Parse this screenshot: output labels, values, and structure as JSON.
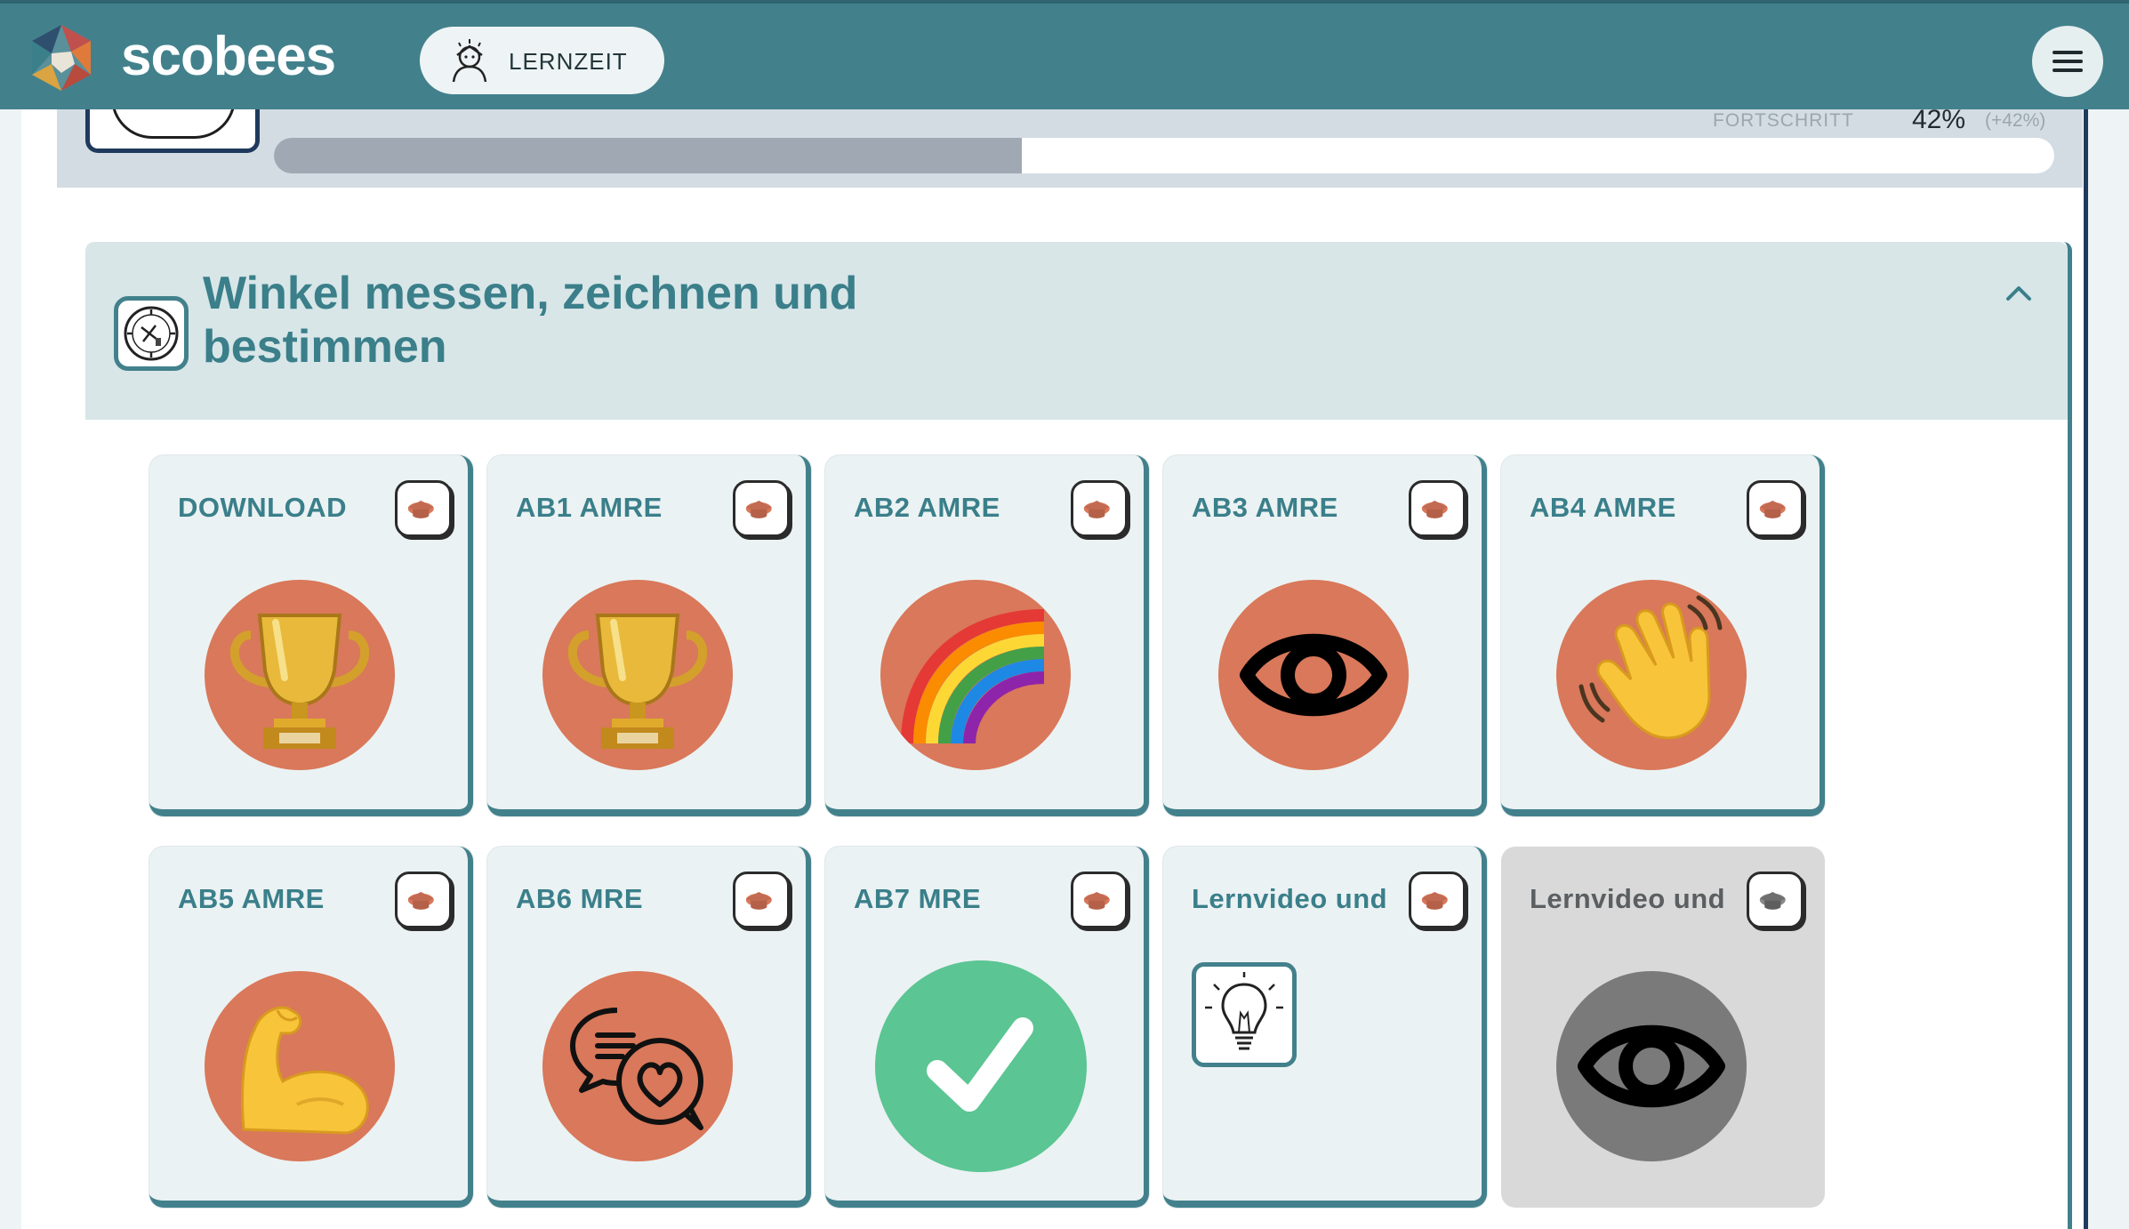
{
  "header": {
    "brand": "scobees",
    "chip_label": "LERNZEIT",
    "icons": {
      "logo": "scobees-logo-icon",
      "chip": "teacher-avatar-icon",
      "menu": "hamburger-menu-icon"
    }
  },
  "progress": {
    "label": "FORTSCHRITT",
    "value": "42%",
    "delta": "(+42%)",
    "fraction": 0.42
  },
  "section": {
    "title": "Winkel messen, zeichnen und bestimmen",
    "icon": "protractor-icon",
    "collapse_icon": "chevron-up-icon"
  },
  "cards": [
    {
      "title": "DOWNLOAD",
      "icon": "trophy-icon",
      "state": "active"
    },
    {
      "title": "AB1 AMRE",
      "icon": "trophy-icon",
      "state": "active"
    },
    {
      "title": "AB2 AMRE",
      "icon": "rainbow-icon",
      "state": "active"
    },
    {
      "title": "AB3 AMRE",
      "icon": "eye-icon",
      "state": "active"
    },
    {
      "title": "AB4 AMRE",
      "icon": "waving-hand-icon",
      "state": "active"
    },
    {
      "title": "AB5 AMRE",
      "icon": "flexed-biceps-icon",
      "state": "active"
    },
    {
      "title": "AB6 MRE",
      "icon": "chat-heart-icon",
      "state": "active"
    },
    {
      "title": "AB7 MRE",
      "icon": "checkmark-icon",
      "state": "completed"
    },
    {
      "title": "Lernvideo und",
      "icon": "lightbulb-icon",
      "state": "active"
    },
    {
      "title": "Lernvideo und",
      "icon": "eye-icon",
      "state": "disabled"
    }
  ],
  "colors": {
    "header": "#42818c",
    "accent": "#3a7f8a",
    "card_bg": "#ebf2f3",
    "icon_circle": "#d9785a",
    "done_green": "#5bc593",
    "disabled": "#d9d9d9",
    "progress_fill": "#9fa8b3"
  }
}
